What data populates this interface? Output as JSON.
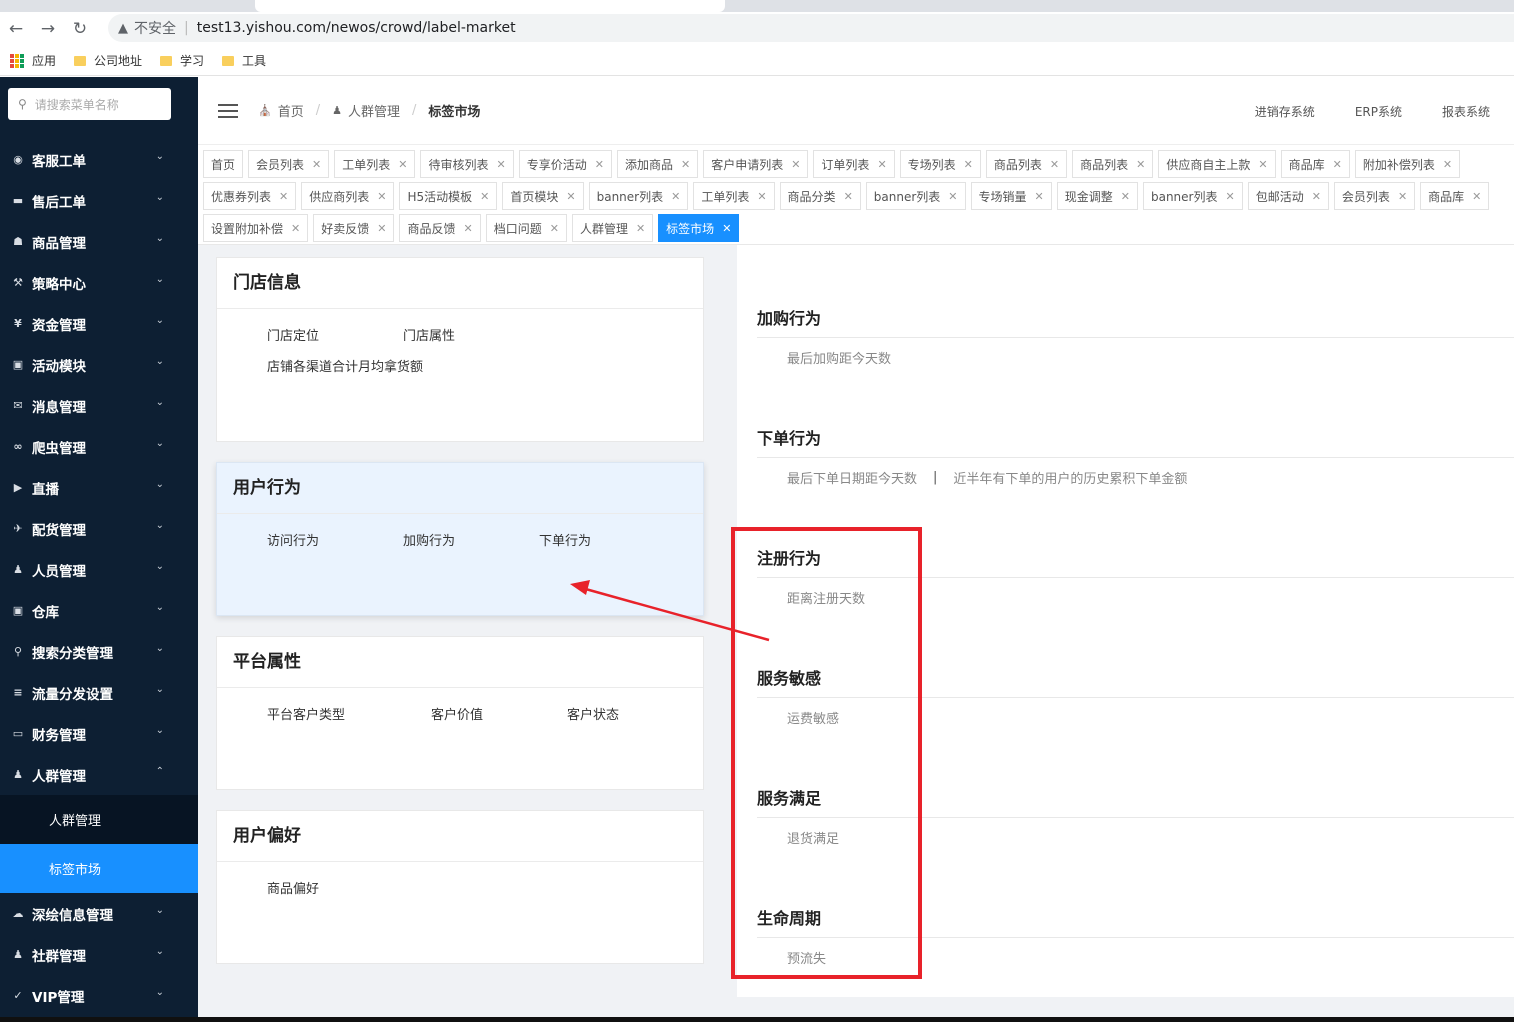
{
  "browser": {
    "insecure": "不安全",
    "url": "test13.yishou.com/newos/crowd/label-market",
    "bookmarks": [
      "应用",
      "公司地址",
      "学习",
      "工具"
    ]
  },
  "sidebar": {
    "search_placeholder": "请搜索菜单名称",
    "items": [
      {
        "label": "客服工单",
        "icon": "headset-icon"
      },
      {
        "label": "售后工单",
        "icon": "document-icon"
      },
      {
        "label": "商品管理",
        "icon": "shirt-icon"
      },
      {
        "label": "策略中心",
        "icon": "hammer-icon"
      },
      {
        "label": "资金管理",
        "icon": "yen-icon"
      },
      {
        "label": "活动模块",
        "icon": "gamepad-icon"
      },
      {
        "label": "消息管理",
        "icon": "mail-icon"
      },
      {
        "label": "爬虫管理",
        "icon": "link-icon"
      },
      {
        "label": "直播",
        "icon": "video-icon"
      },
      {
        "label": "配货管理",
        "icon": "plane-icon"
      },
      {
        "label": "人员管理",
        "icon": "person-icon"
      },
      {
        "label": "仓库",
        "icon": "briefcase-icon"
      },
      {
        "label": "搜索分类管理",
        "icon": "search-icon"
      },
      {
        "label": "流量分发设置",
        "icon": "sliders-icon"
      },
      {
        "label": "财务管理",
        "icon": "card-icon"
      },
      {
        "label": "人群管理",
        "icon": "users-icon"
      }
    ],
    "subitems": [
      "人群管理",
      "标签市场"
    ],
    "items_after": [
      {
        "label": "深绘信息管理",
        "icon": "cloud-icon"
      },
      {
        "label": "社群管理",
        "icon": "group-icon"
      },
      {
        "label": "VIP管理",
        "icon": "vip-icon"
      }
    ]
  },
  "header": {
    "breadcrumb": [
      "首页",
      "人群管理",
      "标签市场"
    ],
    "systems": [
      "进销存系统",
      "ERP系统",
      "报表系统"
    ]
  },
  "tags": {
    "row1": [
      "首页",
      "会员列表",
      "工单列表",
      "待审核列表",
      "专享价活动",
      "添加商品",
      "客户申请列表",
      "订单列表",
      "专场列表",
      "商品列表",
      "商品列表",
      "供应商自主上款",
      "商品库",
      "附加补偿列表"
    ],
    "row2": [
      "优惠券列表",
      "供应商列表",
      "H5活动模板",
      "首页模块",
      "banner列表",
      "工单列表",
      "商品分类",
      "banner列表",
      "专场销量",
      "现金调整",
      "banner列表",
      "包邮活动",
      "会员列表",
      "商品库"
    ],
    "row3": [
      "设置附加补偿",
      "好卖反馈",
      "商品反馈",
      "档口问题",
      "人群管理",
      "标签市场"
    ]
  },
  "cards": [
    {
      "title": "门店信息",
      "items": [
        "门店定位",
        "门店属性",
        "店铺各渠道合计月均拿货额"
      ]
    },
    {
      "title": "用户行为",
      "items": [
        "访问行为",
        "加购行为",
        "下单行为"
      ]
    },
    {
      "title": "平台属性",
      "items": [
        "平台客户类型",
        "客户价值",
        "客户状态"
      ]
    },
    {
      "title": "用户偏好",
      "items": [
        "商品偏好"
      ]
    }
  ],
  "sections": [
    {
      "title": "加购行为",
      "values": [
        "最后加购距今天数"
      ]
    },
    {
      "title": "下单行为",
      "values": [
        "最后下单日期距今天数",
        "近半年有下单的用户的历史累积下单金额"
      ]
    },
    {
      "title": "注册行为",
      "values": [
        "距离注册天数"
      ]
    },
    {
      "title": "服务敏感",
      "values": [
        "运费敏感"
      ]
    },
    {
      "title": "服务满足",
      "values": [
        "退货满足"
      ]
    },
    {
      "title": "生命周期",
      "values": [
        "预流失"
      ]
    }
  ],
  "colors": {
    "sidebar": "#0d1f33",
    "accent": "#1890ff",
    "annotation": "#e8222a"
  }
}
